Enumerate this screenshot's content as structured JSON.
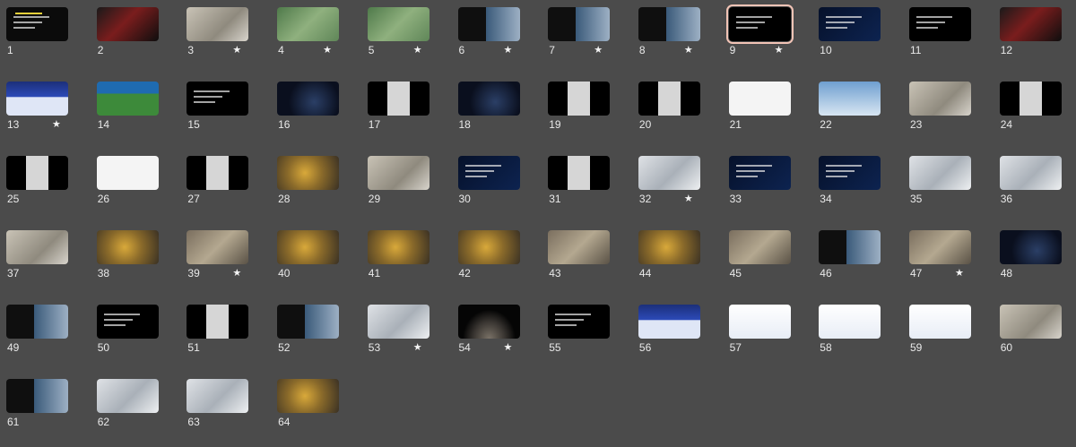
{
  "slides": [
    {
      "num": "1",
      "star": "",
      "style": "t-dark"
    },
    {
      "num": "2",
      "star": "",
      "style": "t-red"
    },
    {
      "num": "3",
      "star": "★",
      "style": "t-lab"
    },
    {
      "num": "4",
      "star": "★",
      "style": "t-green"
    },
    {
      "num": "5",
      "star": "★",
      "style": "t-green"
    },
    {
      "num": "6",
      "star": "★",
      "style": "t-mix"
    },
    {
      "num": "7",
      "star": "★",
      "style": "t-mix"
    },
    {
      "num": "8",
      "star": "★",
      "style": "t-mix"
    },
    {
      "num": "9",
      "star": "★",
      "style": "t-black",
      "selected": true
    },
    {
      "num": "10",
      "star": "",
      "style": "t-navy"
    },
    {
      "num": "11",
      "star": "",
      "style": "t-black"
    },
    {
      "num": "12",
      "star": "",
      "style": "t-red"
    },
    {
      "num": "13",
      "star": "★",
      "style": "t-blueui"
    },
    {
      "num": "14",
      "star": "",
      "style": "t-green2"
    },
    {
      "num": "15",
      "star": "",
      "style": "t-black"
    },
    {
      "num": "16",
      "star": "",
      "style": "t-space"
    },
    {
      "num": "17",
      "star": "",
      "style": "t-split"
    },
    {
      "num": "18",
      "star": "",
      "style": "t-space"
    },
    {
      "num": "19",
      "star": "",
      "style": "t-split"
    },
    {
      "num": "20",
      "star": "",
      "style": "t-split"
    },
    {
      "num": "21",
      "star": "",
      "style": "t-white"
    },
    {
      "num": "22",
      "star": "",
      "style": "t-sky"
    },
    {
      "num": "23",
      "star": "",
      "style": "t-lab"
    },
    {
      "num": "24",
      "star": "",
      "style": "t-split"
    },
    {
      "num": "25",
      "star": "",
      "style": "t-split"
    },
    {
      "num": "26",
      "star": "",
      "style": "t-white"
    },
    {
      "num": "27",
      "star": "",
      "style": "t-split"
    },
    {
      "num": "28",
      "star": "",
      "style": "t-gold"
    },
    {
      "num": "29",
      "star": "",
      "style": "t-lab"
    },
    {
      "num": "30",
      "star": "",
      "style": "t-navy"
    },
    {
      "num": "31",
      "star": "",
      "style": "t-split"
    },
    {
      "num": "32",
      "star": "★",
      "style": "t-room"
    },
    {
      "num": "33",
      "star": "",
      "style": "t-navy"
    },
    {
      "num": "34",
      "star": "",
      "style": "t-navy"
    },
    {
      "num": "35",
      "star": "",
      "style": "t-room"
    },
    {
      "num": "36",
      "star": "",
      "style": "t-room"
    },
    {
      "num": "37",
      "star": "",
      "style": "t-lab"
    },
    {
      "num": "38",
      "star": "",
      "style": "t-gold"
    },
    {
      "num": "39",
      "star": "★",
      "style": "t-photo"
    },
    {
      "num": "40",
      "star": "",
      "style": "t-gold"
    },
    {
      "num": "41",
      "star": "",
      "style": "t-gold"
    },
    {
      "num": "42",
      "star": "",
      "style": "t-gold"
    },
    {
      "num": "43",
      "star": "",
      "style": "t-photo"
    },
    {
      "num": "44",
      "star": "",
      "style": "t-gold"
    },
    {
      "num": "45",
      "star": "",
      "style": "t-photo"
    },
    {
      "num": "46",
      "star": "",
      "style": "t-mix"
    },
    {
      "num": "47",
      "star": "★",
      "style": "t-photo"
    },
    {
      "num": "48",
      "star": "",
      "style": "t-space"
    },
    {
      "num": "49",
      "star": "",
      "style": "t-mix"
    },
    {
      "num": "50",
      "star": "",
      "style": "t-black"
    },
    {
      "num": "51",
      "star": "",
      "style": "t-split"
    },
    {
      "num": "52",
      "star": "",
      "style": "t-mix"
    },
    {
      "num": "53",
      "star": "★",
      "style": "t-room"
    },
    {
      "num": "54",
      "star": "★",
      "style": "t-moon"
    },
    {
      "num": "55",
      "star": "",
      "style": "t-black"
    },
    {
      "num": "56",
      "star": "",
      "style": "t-blueui"
    },
    {
      "num": "57",
      "star": "",
      "style": "t-whiteui"
    },
    {
      "num": "58",
      "star": "",
      "style": "t-whiteui"
    },
    {
      "num": "59",
      "star": "",
      "style": "t-whiteui"
    },
    {
      "num": "60",
      "star": "",
      "style": "t-lab"
    },
    {
      "num": "61",
      "star": "",
      "style": "t-mix"
    },
    {
      "num": "62",
      "star": "",
      "style": "t-room"
    },
    {
      "num": "63",
      "star": "",
      "style": "t-room"
    },
    {
      "num": "64",
      "star": "",
      "style": "t-gold"
    }
  ]
}
